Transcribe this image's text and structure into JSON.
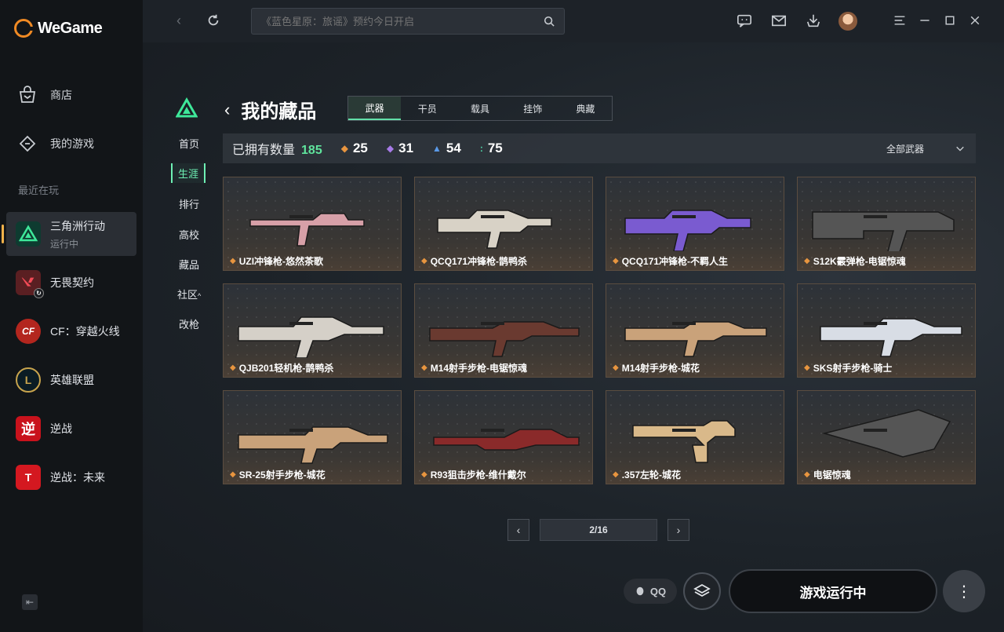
{
  "app": {
    "brand": "WeGame"
  },
  "sidebar": {
    "nav": [
      {
        "label": "商店",
        "icon": "store-bag-icon"
      },
      {
        "label": "我的游戏",
        "icon": "my-games-icon"
      }
    ],
    "recent_label": "最近在玩",
    "games": [
      {
        "name": "三角洲行动",
        "status": "运行中",
        "active": true
      },
      {
        "name": "无畏契约",
        "status": ""
      },
      {
        "name": "CF：穿越火线",
        "status": ""
      },
      {
        "name": "英雄联盟",
        "status": ""
      },
      {
        "name": "逆战",
        "status": ""
      },
      {
        "name": "逆战：未来",
        "status": ""
      }
    ]
  },
  "topbar": {
    "search_placeholder": "《蓝色星原：旅谣》预约今日开启"
  },
  "subnav": [
    "首页",
    "生涯",
    "排行",
    "高校",
    "藏品",
    "社区",
    "改枪"
  ],
  "subnav_active": "生涯",
  "page": {
    "title": "我的藏品",
    "tabs": [
      "武器",
      "干员",
      "载具",
      "挂饰",
      "典藏"
    ],
    "active_tab": "武器",
    "owned_label": "已拥有数量",
    "owned_count": "185",
    "rarity_counts": [
      {
        "value": "25",
        "color": "#e8953f"
      },
      {
        "value": "31",
        "color": "#a77be8"
      },
      {
        "value": "54",
        "color": "#5a9ae8"
      },
      {
        "value": "75",
        "color": "#4fd4a8"
      }
    ],
    "filter": "全部武器"
  },
  "items": [
    {
      "name": "UZI冲锋枪-悠然茶歌",
      "tone": "#d7a0a8"
    },
    {
      "name": "QCQ171冲锋枪-鹊鸭杀",
      "tone": "#d8d2c6"
    },
    {
      "name": "QCQ171冲锋枪-不羁人生",
      "tone": "#7a5bd0"
    },
    {
      "name": "S12K霰弹枪-电锯惊魂",
      "tone": "#555555"
    },
    {
      "name": "QJB201轻机枪-鹊鸭杀",
      "tone": "#d5d0c8"
    },
    {
      "name": "M14射手步枪-电锯惊魂",
      "tone": "#6a3a30"
    },
    {
      "name": "M14射手步枪-城花",
      "tone": "#c9a27a"
    },
    {
      "name": "SKS射手步枪-骑士",
      "tone": "#d8dde5"
    },
    {
      "name": "SR-25射手步枪-城花",
      "tone": "#c9a27a"
    },
    {
      "name": "R93狙击步枪-维什戴尔",
      "tone": "#8a2a2a"
    },
    {
      "name": ".357左轮-城花",
      "tone": "#d9b98a"
    },
    {
      "name": "电锯惊魂",
      "tone": "#555555"
    }
  ],
  "pagination": {
    "text": "2/16"
  },
  "bottom": {
    "qq": "QQ",
    "launch": "游戏运行中"
  }
}
